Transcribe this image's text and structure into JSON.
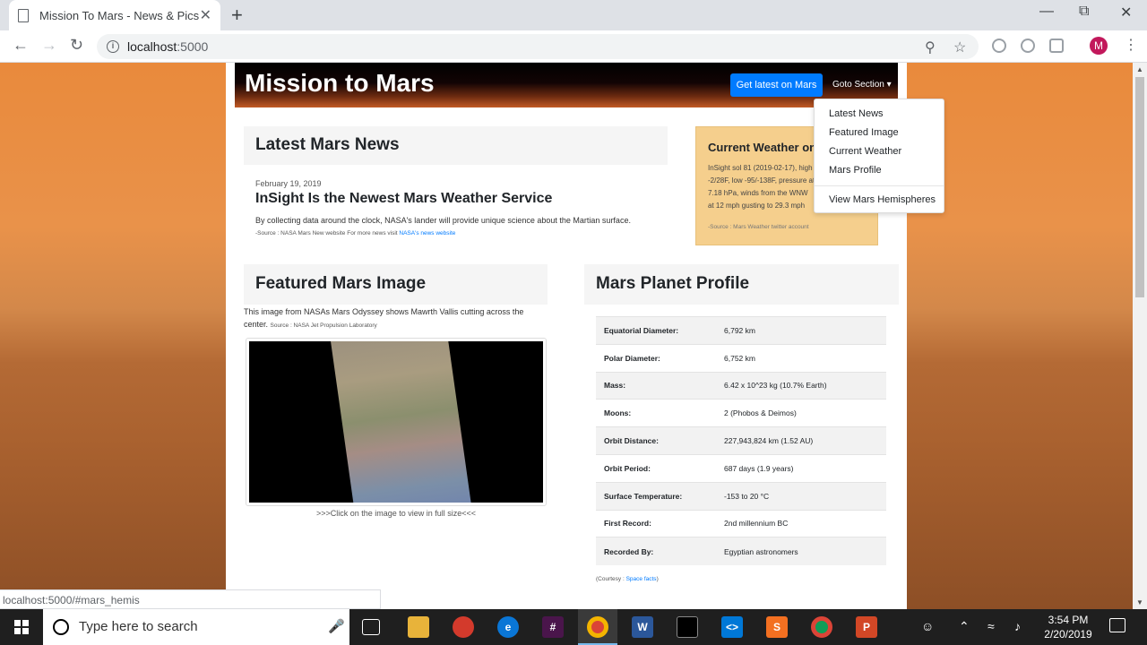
{
  "browser": {
    "tab_title": "Mission To Mars - News & Pics",
    "tab_close": "✕",
    "new_tab": "+",
    "url_host": "localhost",
    "url_port": ":5000",
    "profile_initial": "M",
    "status_url": "localhost:5000/#mars_hemis"
  },
  "site": {
    "brand": "Mission to Mars",
    "latest_button": "Get latest on Mars",
    "goto_label": "Goto Section ▾",
    "dropdown": [
      "Latest News",
      "Featured Image",
      "Current Weather",
      "Mars Profile",
      "View Mars Hemispheres"
    ]
  },
  "news": {
    "heading": "Latest Mars News",
    "date": "February 19, 2019",
    "title": "InSight Is the Newest Mars Weather Service",
    "paragraph": "By collecting data around the clock, NASA's lander will provide unique science about the Martian surface.",
    "source_prefix": "-Source : NASA Mars New website For more news visit ",
    "source_link": "NASA's news website"
  },
  "weather": {
    "heading": "Current Weather on Mars",
    "text": "InSight sol 81 (2019-02-17), high -2/28F, low -95/-138F, pressure at 7.18 hPa, winds from the WNW at 12 mph gusting to 29.3 mph",
    "source": "-Source : Mars Weather twitter account"
  },
  "featured": {
    "heading": "Featured Mars Image",
    "caption": "This image from NASAs Mars Odyssey shows Mawrth Vallis cutting across the center.",
    "source": "Source : NASA Jet Propulsion Laboratory",
    "hint": ">>>Click on the image to view in full size<<<"
  },
  "profile": {
    "heading": "Mars Planet Profile",
    "rows": [
      {
        "k": "Equatorial Diameter:",
        "v": "6,792 km"
      },
      {
        "k": "Polar Diameter:",
        "v": "6,752 km"
      },
      {
        "k": "Mass:",
        "v": "6.42 x 10^23 kg (10.7% Earth)"
      },
      {
        "k": "Moons:",
        "v": "2 (Phobos & Deimos)"
      },
      {
        "k": "Orbit Distance:",
        "v": "227,943,824 km (1.52 AU)"
      },
      {
        "k": "Orbit Period:",
        "v": "687 days (1.9 years)"
      },
      {
        "k": "Surface Temperature:",
        "v": "-153 to 20 °C"
      },
      {
        "k": "First Record:",
        "v": "2nd millennium BC"
      },
      {
        "k": "Recorded By:",
        "v": "Egyptian astronomers"
      }
    ],
    "courtesy_prefix": "(Courtesy : ",
    "courtesy_link": "Space facts",
    "courtesy_suffix": ")"
  },
  "taskbar": {
    "search_placeholder": "Type here to search",
    "time": "3:54 PM",
    "date": "2/20/2019"
  }
}
